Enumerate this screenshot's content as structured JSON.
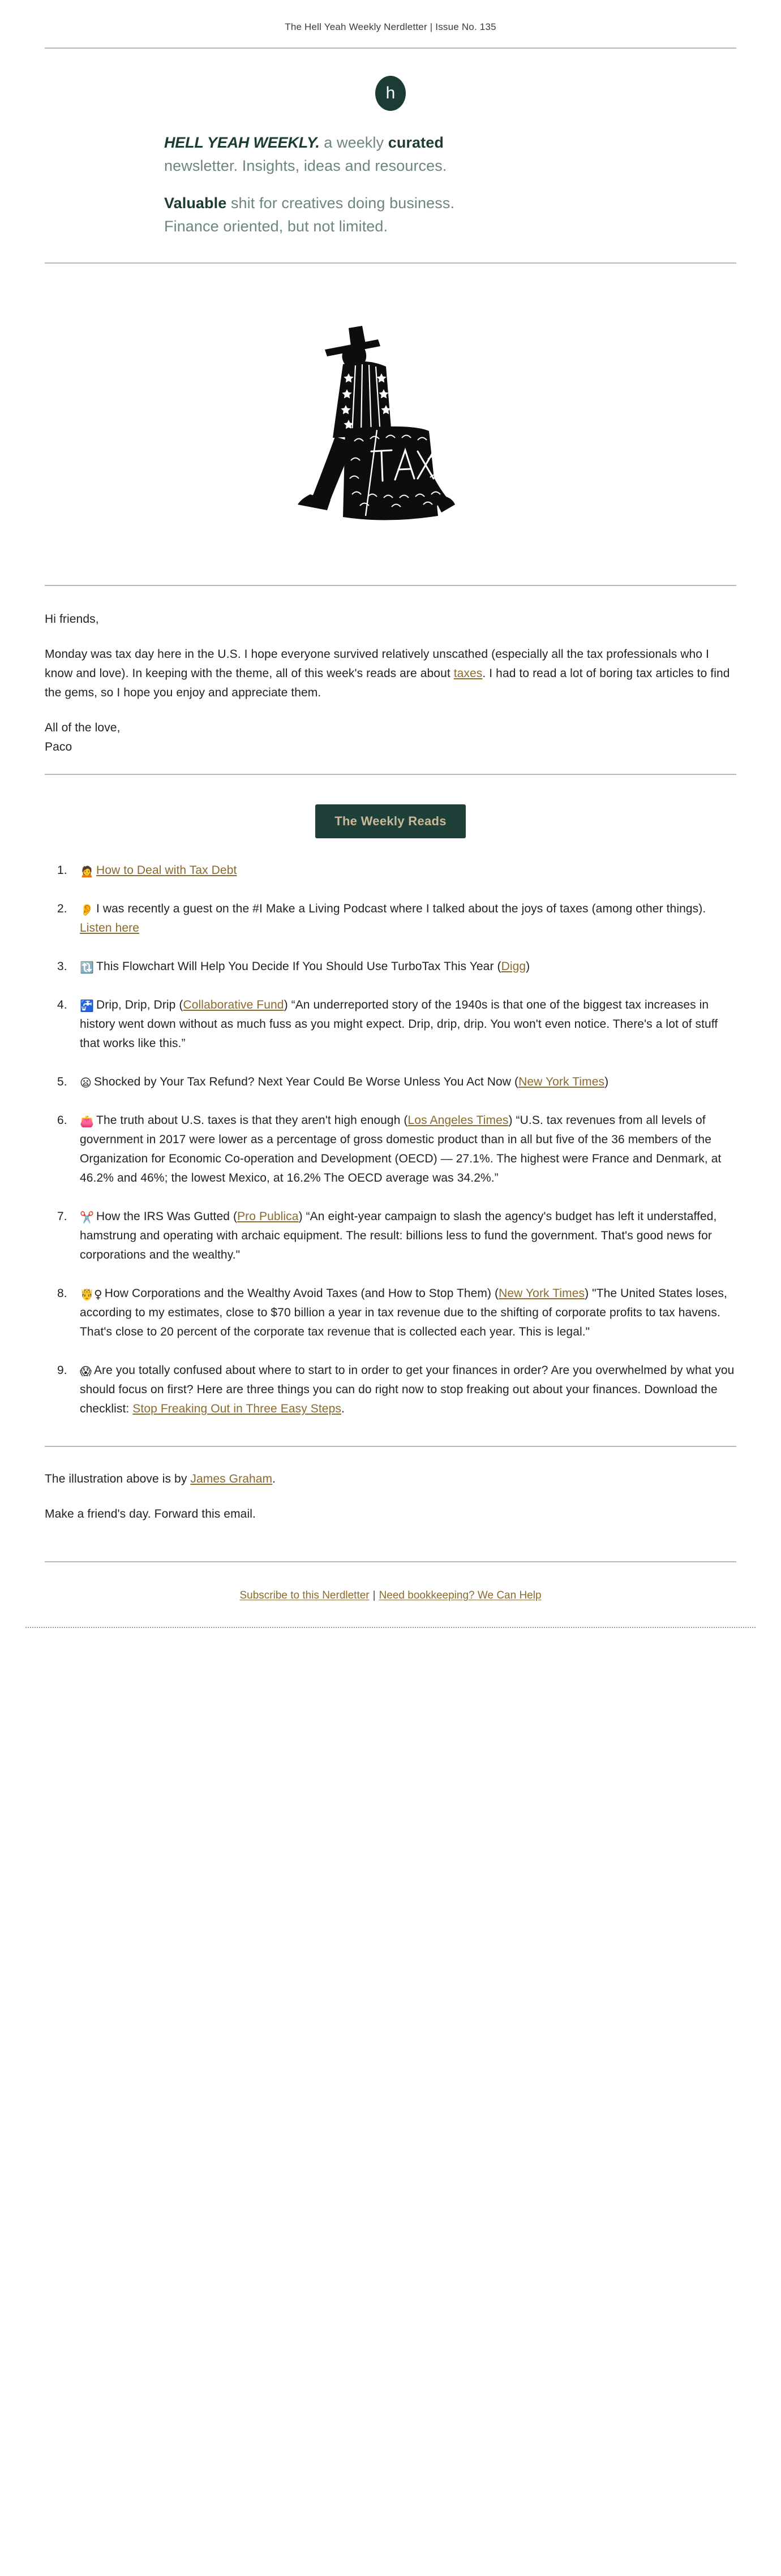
{
  "preheader": "The Hell Yeah Weekly Nerdletter | Issue No. 135",
  "brand": {
    "logo_letter": "h",
    "logo_bg_color": "#1b3c35",
    "accent_green": "#1e4038",
    "accent_tan": "#c9b999",
    "link_color": "#8a6a2f"
  },
  "masthead": {
    "brandname": "HELL YEAH WEEKLY.",
    "line1_rest_a": " a weekly ",
    "line1_em": "curated",
    "line2": "newsletter. Insights, ideas and resources.",
    "line3_em": "Valuable",
    "line3_rest": " shit for creatives doing business.",
    "line4": "Finance oriented, but not limited."
  },
  "illustration": {
    "alt_name": "uncle-sam-with-tax-bag-illustration",
    "word_on_bag": "TAX"
  },
  "intro": {
    "greeting": "Hi friends,",
    "paragraph_a": "Monday was tax day here in the U.S. I hope everyone survived relatively unscathed (especially all the tax professionals who I know and love). In keeping with the theme, all of this week's reads are about ",
    "paragraph_link": "taxes",
    "paragraph_b": ". I had to read a lot of boring tax articles to find the gems, so I hope you enjoy and appreciate them.",
    "signoff_line1": "All of the love,",
    "signoff_line2": "Paco"
  },
  "banner": {
    "label": "The Weekly Reads"
  },
  "reads": [
    {
      "number": "1.",
      "emoji": "🙍",
      "emoji_name": "person-frowning-icon",
      "link_text": "How to Deal with Tax Debt",
      "whole_item_is_link": true
    },
    {
      "number": "2.",
      "emoji": "👂",
      "emoji_name": "ear-icon",
      "text_a": "I was recently a guest on the #I Make a Living Podcast where I talked about the joys of taxes (among other things). ",
      "link_text": "Listen here",
      "text_b": ""
    },
    {
      "number": "3.",
      "emoji": "🔃",
      "emoji_name": "clockwise-vertical-arrows-icon",
      "text_a": "This Flowchart Will Help You Decide If You Should Use TurboTax This Year (",
      "link_text": "Digg",
      "text_b": ")"
    },
    {
      "number": "4.",
      "emoji": "🚰",
      "emoji_name": "potable-water-icon",
      "text_a": "Drip, Drip, Drip (",
      "link_text": "Collaborative Fund",
      "text_b": ") “An underreported story of the 1940s is that one of the biggest tax increases in history went down without as much fuss as you might expect. Drip, drip, drip. You won't even notice. There's a lot of stuff that works like this.”"
    },
    {
      "number": "5.",
      "emoji": "😦",
      "emoji_name": "anguished-face-icon",
      "text_a": "Shocked by Your Tax Refund? Next Year Could Be Worse Unless You Act Now (",
      "link_text": "New York Times",
      "text_b": ")"
    },
    {
      "number": "6.",
      "emoji": "👛",
      "emoji_name": "purse-icon",
      "text_a": "The truth about U.S. taxes is that they aren't high enough (",
      "link_text": "Los Angeles Times",
      "text_b": ") “U.S. tax revenues from all levels of government in 2017 were lower as a percentage of gross domestic product than in all but five of the 36 members of the Organization for Economic Co-operation and Development (OECD) — 27.1%. The highest were France and Denmark, at 46.2% and 46%; the lowest Mexico, at 16.2% The OECD average was 34.2%.”"
    },
    {
      "number": "7.",
      "emoji": "✂️",
      "emoji_name": "scissors-icon",
      "text_a": "How the IRS Was Gutted (",
      "link_text": "Pro Publica",
      "text_b": ") “An eight-year campaign to slash the agency's budget has left it understaffed, hamstrung and operating with archaic equipment. The result: billions less to fund the government. That's good news for corporations and the wealthy.\""
    },
    {
      "number": "8.",
      "emoji": "🤴♀",
      "emoji_name": "prince-female-sign-icon",
      "text_a": "How Corporations and the Wealthy Avoid Taxes (and How to Stop Them) (",
      "link_text": "New York Times",
      "text_b": ") \"The United States loses, according to my estimates, close to $70 billion a year in tax revenue due to the shifting of corporate profits to tax havens. That's close to 20 percent of the corporate tax revenue that is collected each year. This is legal.\""
    },
    {
      "number": "9.",
      "emoji": "😱",
      "emoji_name": "screaming-face-icon",
      "text_a": "Are you totally confused about where to start to in order to get your finances in order? Are you overwhelmed by what you should focus on first? Here are three things you can do right now to stop freaking out about your finances. Download the checklist: ",
      "link_text": "Stop Freaking Out in Three Easy Steps",
      "text_b": "."
    }
  ],
  "footer": {
    "credit_prefix": "The illustration above is by ",
    "credit_link": "James Graham",
    "credit_suffix": ".",
    "forward_line": "Make a friend's day. Forward this email.",
    "subscribe_link": "Subscribe to this Nerdletter",
    "separator": "|",
    "bookkeeping_link": "Need bookkeeping? We Can Help"
  }
}
